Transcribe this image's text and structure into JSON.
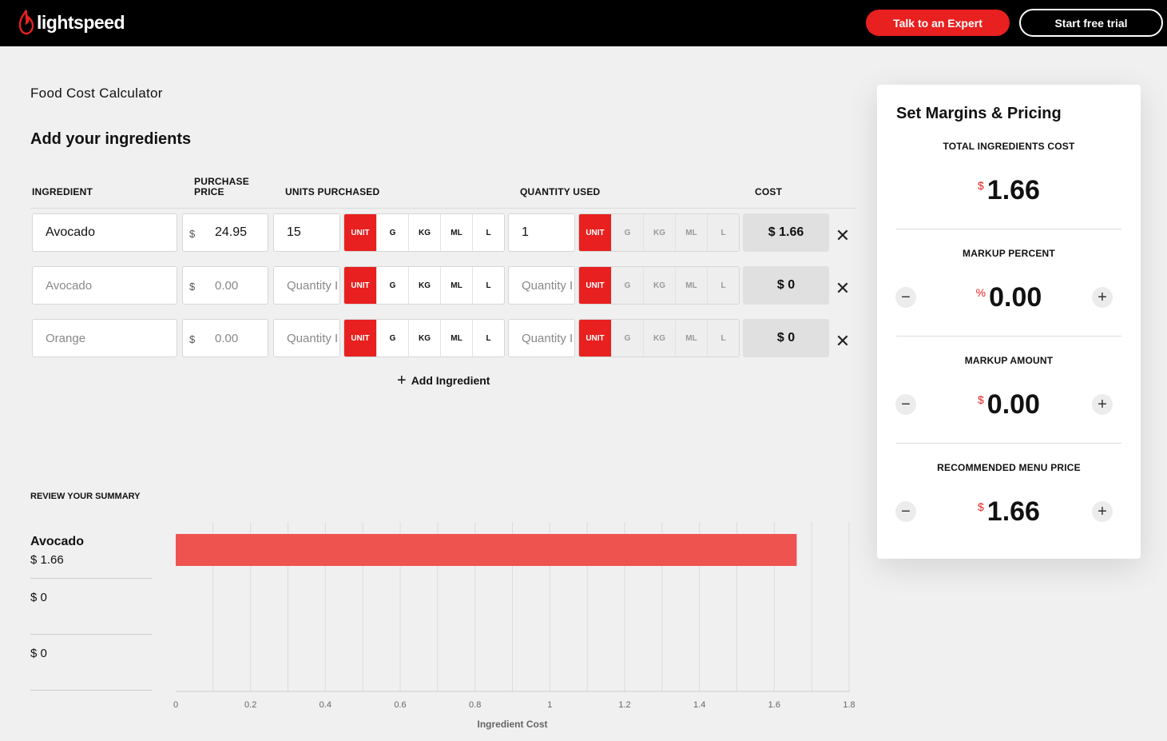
{
  "header": {
    "logo_text": "lightspeed",
    "expert_label": "Talk to an Expert",
    "trial_label": "Start free trial"
  },
  "page_title": "Food Cost Calculator",
  "section_title": "Add your ingredients",
  "columns": {
    "ingredient": "INGREDIENT",
    "purchase_price_1": "PURCHASE",
    "purchase_price_2": "PRICE",
    "units_purchased": "UNITS PURCHASED",
    "quantity_used": "QUANTITY USED",
    "cost": "COST"
  },
  "units": [
    "UNIT",
    "G",
    "KG",
    "ML",
    "L"
  ],
  "rows": [
    {
      "ingredient_value": "Avocado",
      "ingredient_placeholder": "",
      "currency": "$",
      "price_value": "24.95",
      "price_placeholder": "",
      "units_value": "15",
      "units_placeholder": "",
      "qty_value": "1",
      "qty_placeholder": "",
      "cost": "$ 1.66",
      "remove": "✕"
    },
    {
      "ingredient_value": "",
      "ingredient_placeholder": "Avocado",
      "currency": "$",
      "price_value": "",
      "price_placeholder": "0.00",
      "units_value": "",
      "units_placeholder": "Quantity I",
      "qty_value": "",
      "qty_placeholder": "Quantity I",
      "cost": "$ 0",
      "remove": "✕"
    },
    {
      "ingredient_value": "",
      "ingredient_placeholder": "Orange",
      "currency": "$",
      "price_value": "",
      "price_placeholder": "0.00",
      "units_value": "",
      "units_placeholder": "Quantity I",
      "qty_value": "",
      "qty_placeholder": "Quantity I",
      "cost": "$ 0",
      "remove": "✕"
    }
  ],
  "add_ingredient": {
    "icon": "plus-icon",
    "label": "Add Ingredient"
  },
  "summary": {
    "title": "REVIEW YOUR SUMMARY",
    "legend": [
      {
        "name": "Avocado",
        "value": "$ 1.66"
      },
      {
        "name": "",
        "value": "$ 0"
      },
      {
        "name": "",
        "value": "$ 0"
      }
    ]
  },
  "chart_data": {
    "type": "bar",
    "orientation": "horizontal",
    "categories": [
      "Avocado",
      "",
      ""
    ],
    "values": [
      1.66,
      0,
      0
    ],
    "xlabel": "Ingredient Cost",
    "xlim": [
      0,
      1.8
    ],
    "xticks": [
      "0",
      "0.2",
      "0.4",
      "0.6",
      "0.8",
      "1",
      "1.2",
      "1.4",
      "1.6",
      "1.8"
    ],
    "bar_color": "#ef5350",
    "grid": true
  },
  "panel": {
    "title": "Set Margins & Pricing",
    "total_label": "TOTAL INGREDIENTS COST",
    "total_currency": "$",
    "total_value": "1.66",
    "markup_percent_label": "MARKUP PERCENT",
    "markup_percent_symbol": "%",
    "markup_percent_value": "0.00",
    "markup_amount_label": "MARKUP AMOUNT",
    "markup_amount_currency": "$",
    "markup_amount_value": "0.00",
    "menu_price_label": "RECOMMENDED MENU PRICE",
    "menu_price_currency": "$",
    "menu_price_value": "1.66",
    "minus": "−",
    "plus": "+"
  },
  "colors": {
    "accent": "#e8201f",
    "bar": "#ef5350",
    "header_bg": "#000000"
  }
}
